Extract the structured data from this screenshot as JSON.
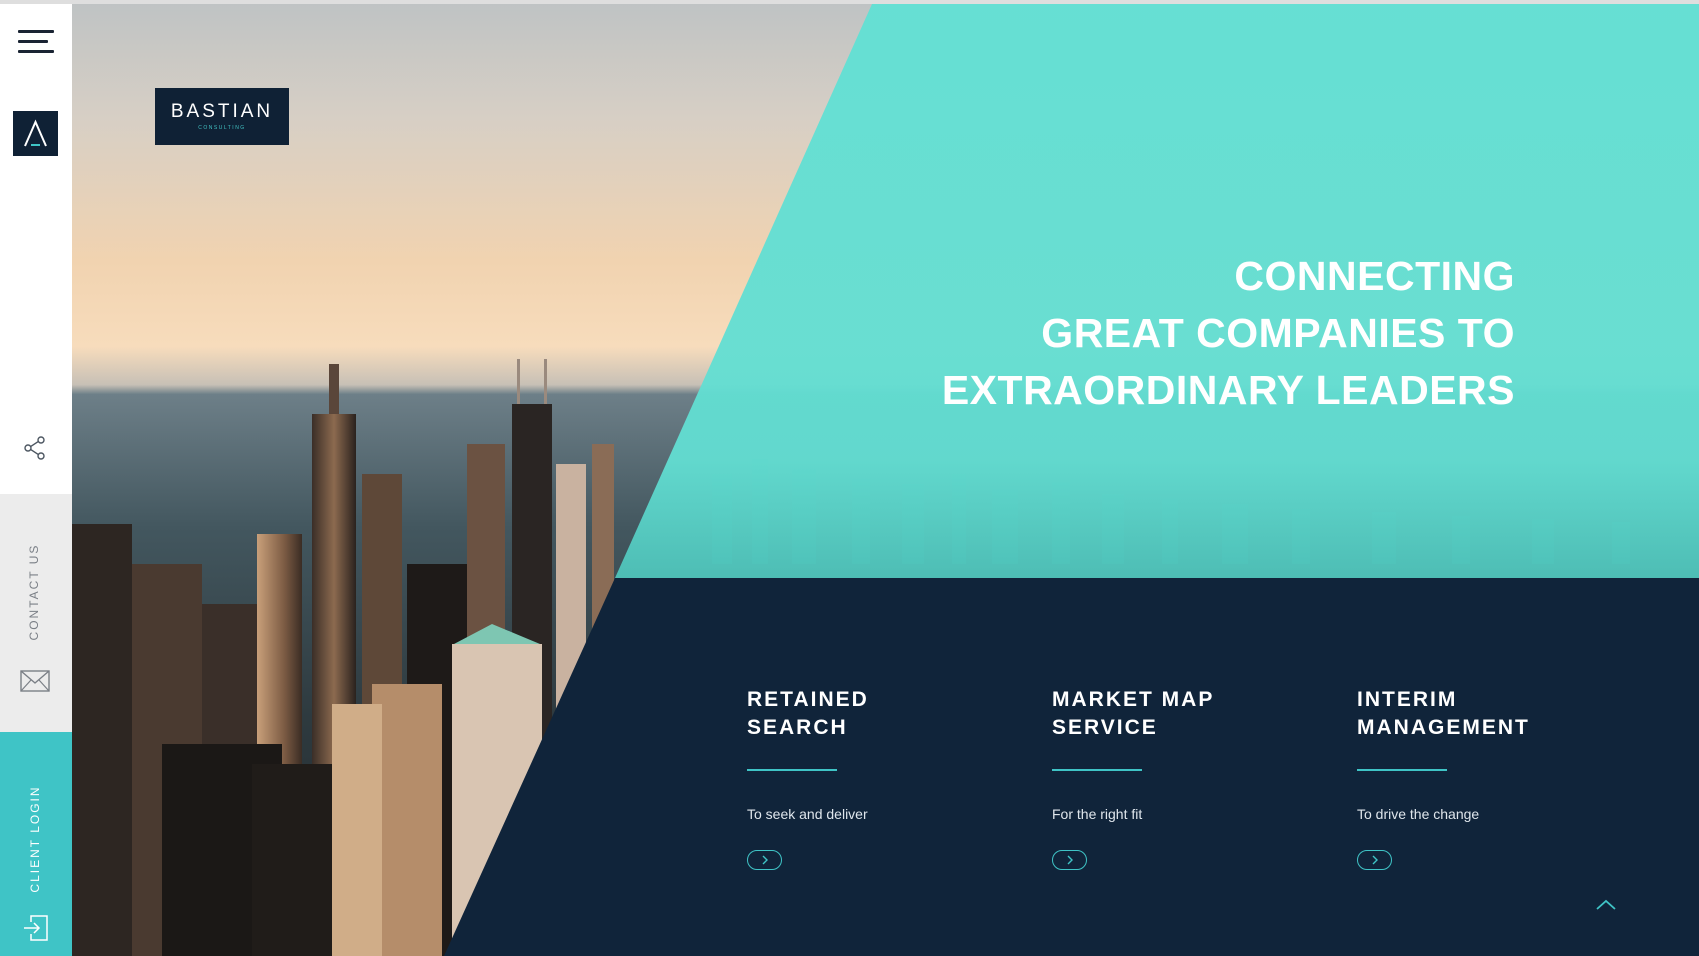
{
  "sidebar": {
    "menu_icon": "hamburger-menu-icon",
    "brand_icon": "bastian-a-mark-icon",
    "share_icon": "share-icon",
    "contact_label": "CONTACT US",
    "contact_icon": "mail-icon",
    "login_label": "CLIENT LOGIN",
    "login_icon": "login-icon"
  },
  "logo": {
    "name": "BASTIAN",
    "subtitle": "CONSULTING"
  },
  "hero": {
    "headline": [
      "CONNECTING",
      "GREAT COMPANIES TO",
      "EXTRAORDINARY LEADERS"
    ]
  },
  "services": [
    {
      "title": "RETAINED\nSEARCH",
      "description": "To seek and deliver"
    },
    {
      "title": "MARKET MAP\nSERVICE",
      "description": "For the right fit"
    },
    {
      "title": "INTERIM\nMANAGEMENT",
      "description": "To drive the change"
    }
  ],
  "colors": {
    "accent": "#3fc4c6",
    "navy": "#10243a",
    "teal_overlay": "#62e0d4",
    "sidebar_grey": "#ececec"
  },
  "scroll_top_icon": "chevron-up-icon"
}
